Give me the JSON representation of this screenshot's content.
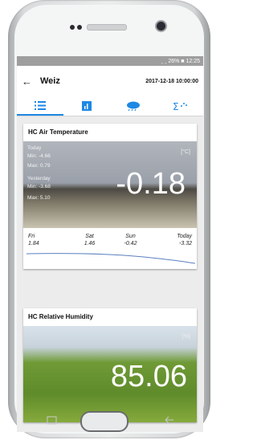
{
  "status": {
    "text": "¸ ¸ 26% ■ 12:25"
  },
  "header": {
    "back_icon": "arrow-left-icon",
    "title": "Weiz",
    "datetime": "2017-12-18 10:00:00"
  },
  "tabs": [
    {
      "icon": "list-icon",
      "active": true
    },
    {
      "icon": "chart-icon",
      "active": false
    },
    {
      "icon": "weather-icon",
      "active": false
    },
    {
      "icon": "sum-icon",
      "active": false
    }
  ],
  "air": {
    "title": "HC Air Temperature",
    "today_label": "Today",
    "today_min": "Min:  -4.66",
    "today_max": "Max:  0.79",
    "yesterday_label": "Yesterday",
    "yest_min": "Min:  -3.68",
    "yest_max": "Max:  5.10",
    "unit": "[°C]",
    "value": "-0.18",
    "forecast": [
      {
        "day": "Fri",
        "value": "1.84"
      },
      {
        "day": "Sat",
        "value": "1.46"
      },
      {
        "day": "Sun",
        "value": "-0.42"
      },
      {
        "day": "Today",
        "value": "-3.32"
      }
    ]
  },
  "humidity": {
    "title": "HC Relative Humidity",
    "unit": "[%]",
    "value": "85.06"
  },
  "colors": {
    "accent": "#1e88e5",
    "tab_icon": "#1e88e5"
  }
}
